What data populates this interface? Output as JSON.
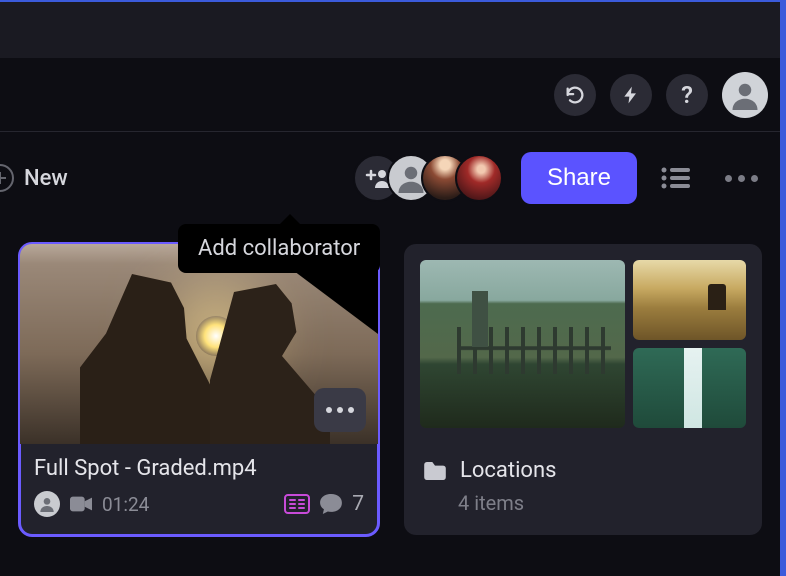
{
  "toolbar": {
    "new_label": "New",
    "share_label": "Share",
    "tooltip_add_collaborator": "Add collaborator"
  },
  "cards": {
    "video": {
      "title": "Full Spot - Graded.mp4",
      "duration": "01:24",
      "comment_count": "7"
    },
    "folder": {
      "name": "Locations",
      "item_count": "4 items"
    }
  }
}
